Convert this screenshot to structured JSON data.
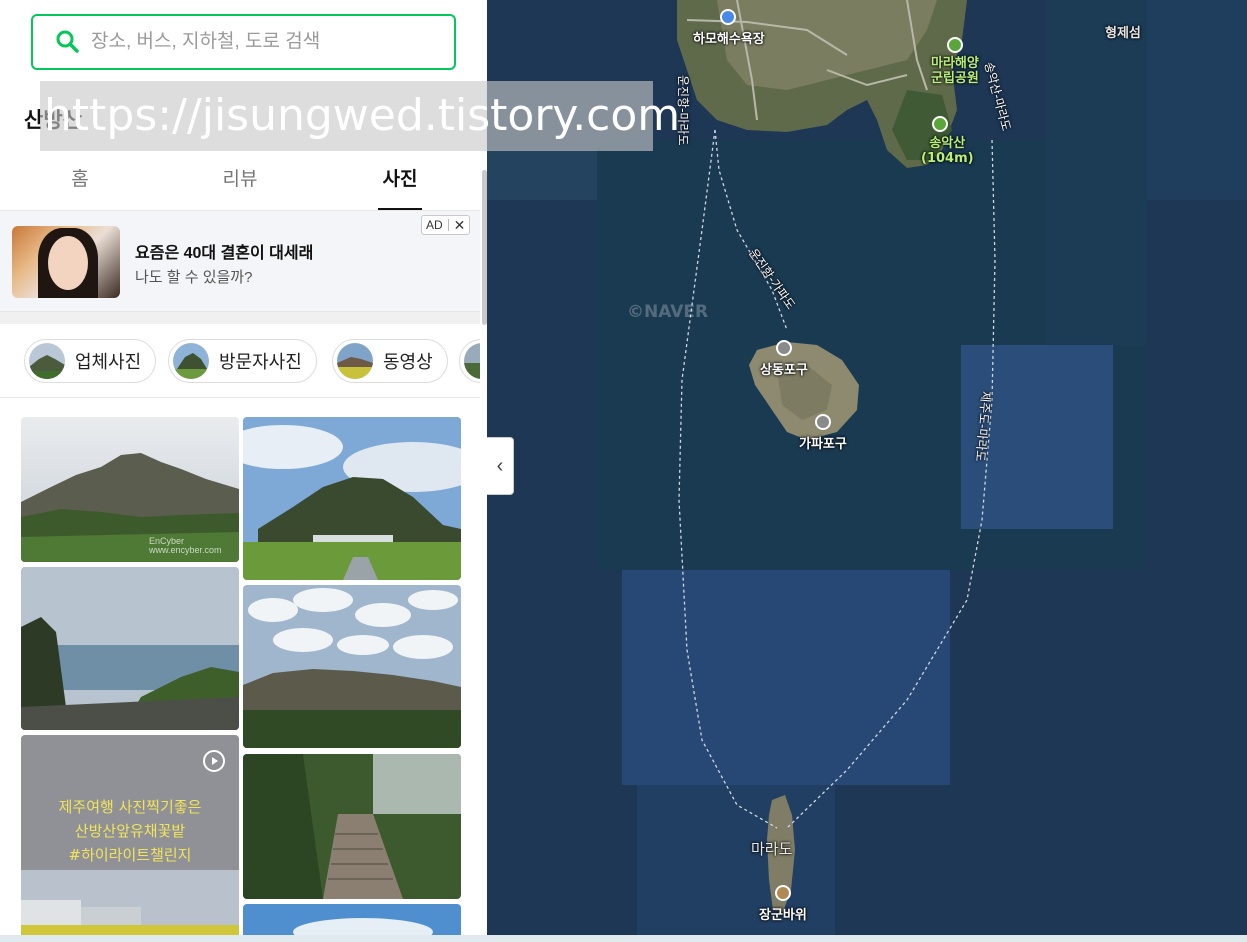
{
  "search": {
    "placeholder": "장소, 버스, 지하철, 도로 검색",
    "value": ""
  },
  "place": {
    "title": "산방산",
    "close_label": "×"
  },
  "tabs": [
    {
      "label": "홈",
      "active": false
    },
    {
      "label": "리뷰",
      "active": false
    },
    {
      "label": "사진",
      "active": true
    }
  ],
  "ad": {
    "title": "요즘은 40대 결혼이 대세래",
    "subtitle": "나도 할 수 있을까?",
    "badge": "AD",
    "close": "✕"
  },
  "chips": [
    {
      "label": "업체사진"
    },
    {
      "label": "방문자사진"
    },
    {
      "label": "동영상"
    }
  ],
  "photos": [
    {
      "watermark": "EnCyber\nwww.encyber.com"
    },
    {
      "overlay": ""
    },
    {
      "overlay": ""
    },
    {
      "overlay": ""
    },
    {
      "overlay": "제주여행 사진찍기좋은\n산방산앞유채꽃밭\n#하이라이트챌린지"
    },
    {
      "overlay": ""
    },
    {
      "overlay": ""
    }
  ],
  "watermark_text": "https://jisungwed.tistory.com",
  "map": {
    "labels": {
      "hamo_beach": "하모해수욕장",
      "marine_park": "마라해양\n군립공원",
      "songaksan": "송악산\n(104m)",
      "hyeongje": "형제섬",
      "sangdong": "상동포구",
      "gapa": "가파포구",
      "marado": "마라도",
      "janggun": "장군바위",
      "route_west": "운진항-마라도",
      "route_gapa": "운진항-가파도",
      "route_east": "송악산-마라도",
      "route_jeju": "제주도-마라도",
      "naver": "©NAVER"
    },
    "collapse_icon": "‹"
  },
  "colors": {
    "accent": "#03c75a"
  }
}
